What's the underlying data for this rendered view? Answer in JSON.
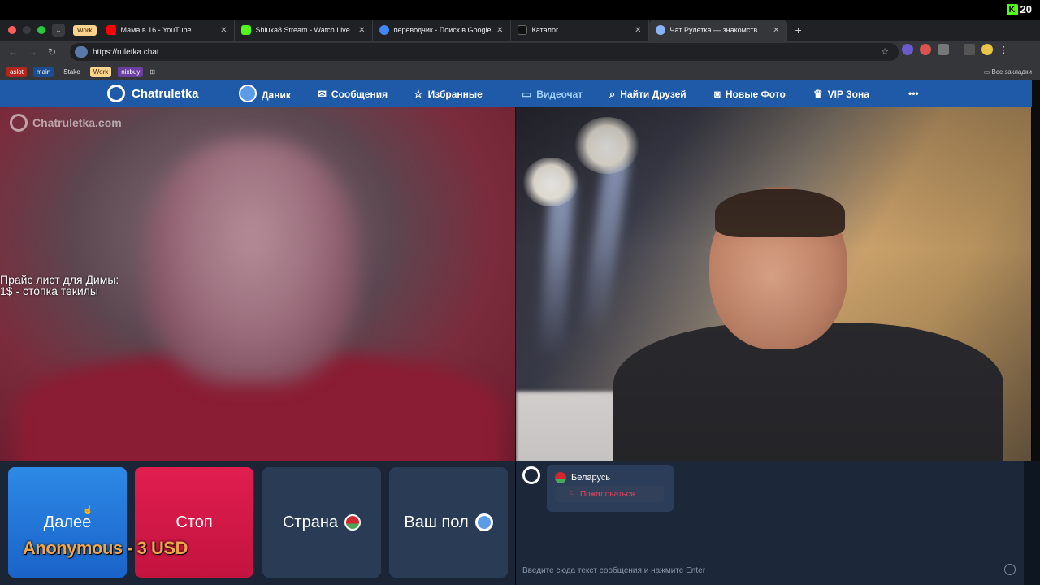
{
  "stream": {
    "badge_logo": "K",
    "viewer_count": "20"
  },
  "browser": {
    "tab_group_label": "Work",
    "tabs": [
      {
        "title": "Мама в 16 - YouTube",
        "fav_color": "#ff0000"
      },
      {
        "title": "Shluxa8 Stream - Watch Live",
        "fav_color": "#53fc18"
      },
      {
        "title": "переводчик - Поиск в Google",
        "fav_color": "#4285f4"
      },
      {
        "title": "Каталог",
        "fav_color": "#111111"
      },
      {
        "title": "Чат Рулетка — знакомств",
        "fav_color": "#8ab4f8"
      }
    ],
    "url": "https://ruletka.chat",
    "bookmarks": [
      {
        "label": "aslot",
        "bg": "#b3261e",
        "fg": "#ffffff"
      },
      {
        "label": "main",
        "bg": "#1a4d8f",
        "fg": "#ffffff"
      },
      {
        "label": "Stake",
        "bg": "transparent",
        "fg": "#e8eaed"
      },
      {
        "label": "Work",
        "bg": "#fbd38d",
        "fg": "#3a2a00"
      },
      {
        "label": "nixbuy",
        "bg": "#6b3fa0",
        "fg": "#ffffff"
      }
    ],
    "all_bookmarks": "Все закладки"
  },
  "site": {
    "brand": "Chatruletka",
    "nav": {
      "user": "Даник",
      "messages": "Сообщения",
      "favorites": "Избранные",
      "videochat": "Видеочат",
      "find_friends": "Найти Друзей",
      "new_photos": "Новые Фото",
      "vip": "VIP Зона",
      "more": "•••"
    },
    "active_nav": "videochat",
    "watermark": "Chatruletka.com"
  },
  "overlay": {
    "price_line1": "Прайс лист для Димы:",
    "price_line2": "1$ - стопка текилы",
    "donation": "Anonymous - 3 USD"
  },
  "controls": {
    "next": "Далее",
    "stop": "Стоп",
    "country": "Страна",
    "gender": "Ваш пол"
  },
  "chat": {
    "partner_country": "Беларусь",
    "report": "Пожаловаться",
    "input_placeholder": "Введите сюда текст сообщения и нажмите Enter"
  },
  "colors": {
    "nav_bg": "#1e5aa8",
    "next_btn": "#1a63c9",
    "stop_btn": "#c3133f",
    "panel_bg": "#1c283a"
  }
}
